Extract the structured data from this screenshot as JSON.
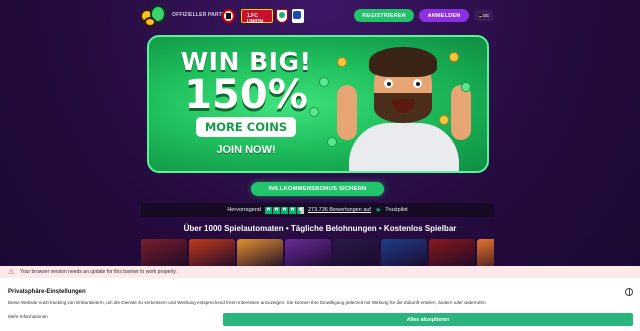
{
  "header": {
    "partner_label": "OFFIZIELLER PARTNER",
    "club_2_label": "1.FC UNION",
    "register_label": "REGISTRIEREN",
    "login_label": "ANMELDEN",
    "language": "DE"
  },
  "hero": {
    "line1": "WIN BIG!",
    "line2": "150%",
    "line3": "MORE COINS",
    "line4": "JOIN NOW!"
  },
  "bonus_button_label": "WILLKOMMENSBONUS SICHERN",
  "trustpilot": {
    "rating_text": "Hervorragend",
    "reviews_text": "273.736 Bewertungen auf",
    "brand": "Trustpilot",
    "stars": 4.5
  },
  "tagline": "Über 1000 Spielautomaten • Tägliche Belohnungen • Kostenlos Spielbar",
  "games": [
    {
      "color": "#7a1f2b"
    },
    {
      "color": "#c23a1a"
    },
    {
      "color": "#e2912d"
    },
    {
      "color": "#6a2a9a"
    },
    {
      "color": "#2a1a4a"
    },
    {
      "color": "#1f3d8a"
    },
    {
      "color": "#8a1a1a"
    },
    {
      "color": "#e6742a"
    }
  ],
  "warning": {
    "text": "Your browser version needs an update for this banner to work properly."
  },
  "consent": {
    "title": "Privatsphäre-Einstellungen",
    "text": "Diese Website nutzt tracking von Drittanbietern, um die Dienste zu verbessern und Werbung entsprechend Ihren Interessen anzuzeigen. Sie können Ihre Einwilligung jederzeit mit Wirkung für die Zukunft erteilen, ändern oder widerrufen.",
    "more_info": "Mehr Informationen",
    "accept_label": "Alles akzeptieren"
  },
  "colors": {
    "register": "#20c26a",
    "login": "#8b2fe0",
    "accept": "#2ab57d",
    "trust_green": "#00b67a"
  }
}
